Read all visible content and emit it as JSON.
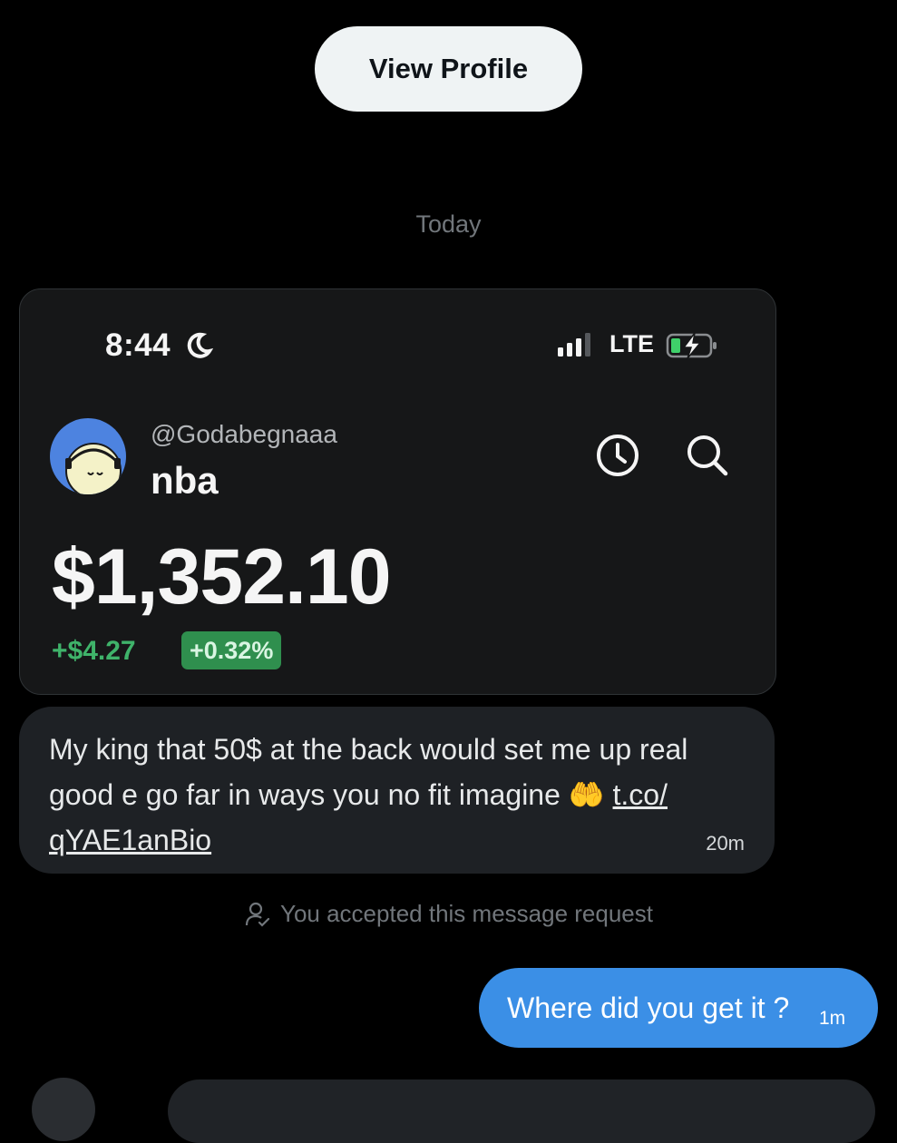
{
  "header": {
    "view_profile_label": "View Profile"
  },
  "conversation": {
    "date_separator": "Today",
    "attachment": {
      "status_bar": {
        "time": "8:44",
        "network": "LTE"
      },
      "account": {
        "handle": "@Godabegnaaa",
        "name": "nba"
      },
      "balance": "$1,352.10",
      "change_amount": "+$4.27",
      "change_percent": "+0.32%",
      "colors": {
        "gain_green": "#3fb36a",
        "badge_green": "#2f8f4e",
        "avatar_blue": "#4d83e0"
      }
    },
    "incoming_message": {
      "text_before_link": "My king that 50$ at the back would set me up real good e go far in ways you no fit imagine 🤲 ",
      "link_part1": "t.co/",
      "link_part2": "qYAE1anBio",
      "time": "20m"
    },
    "system_note": "You accepted this message request",
    "outgoing_message": {
      "text": "Where did you get it ?",
      "time": "1m",
      "color": "#3b8fe6"
    }
  }
}
